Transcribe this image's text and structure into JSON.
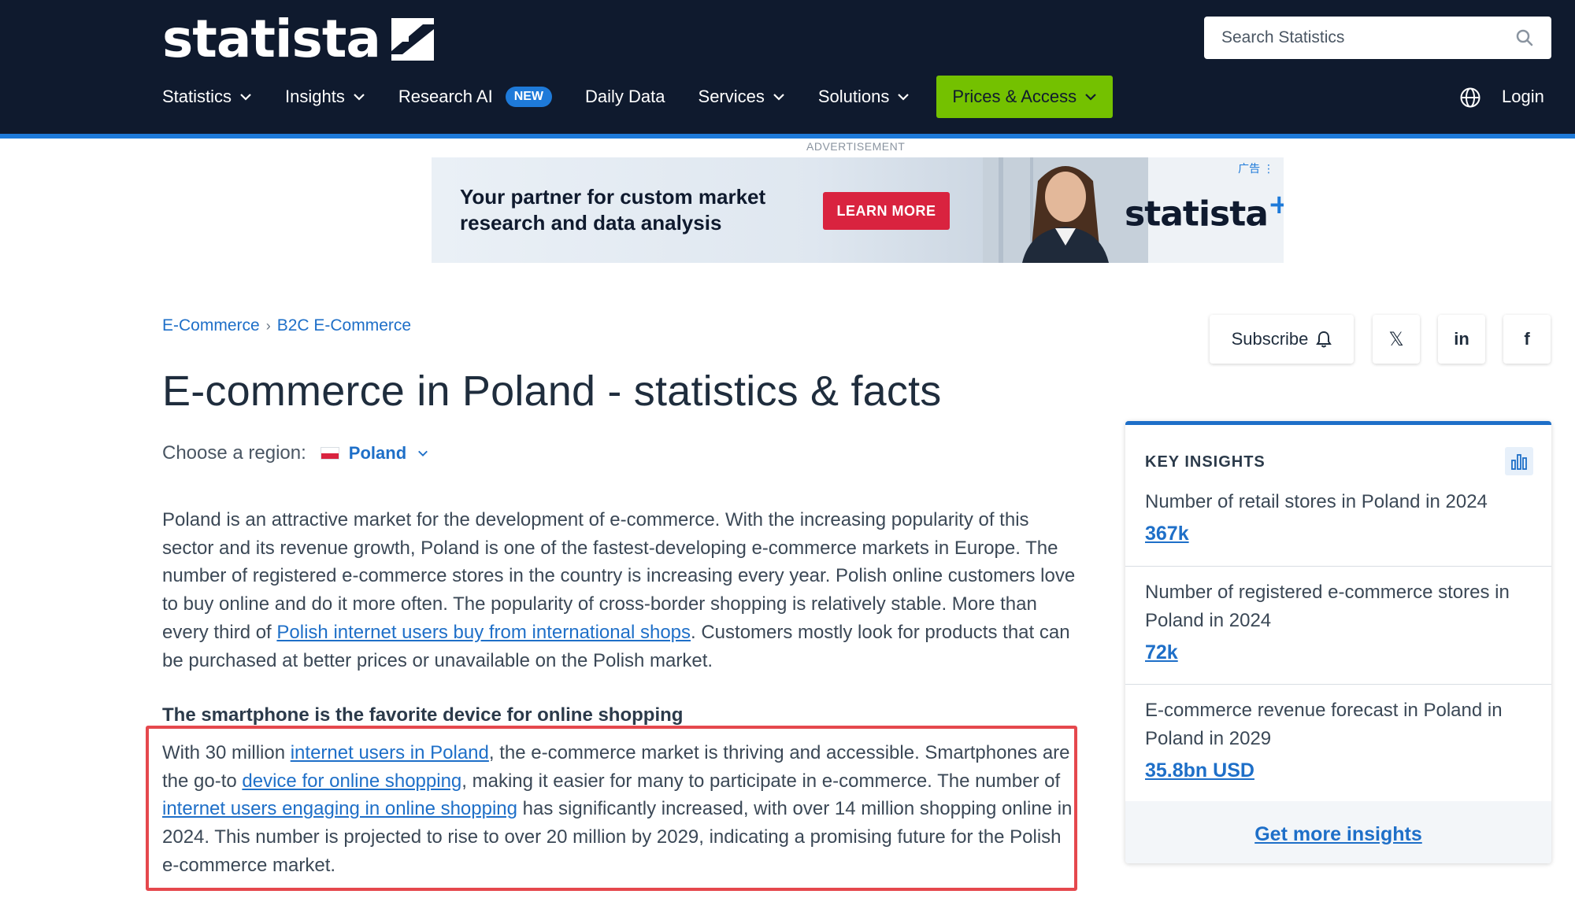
{
  "header": {
    "brand": "statista",
    "search_placeholder": "Search Statistics",
    "nav": [
      {
        "label": "Statistics"
      },
      {
        "label": "Insights"
      },
      {
        "label": "Research AI",
        "badge": "NEW"
      },
      {
        "label": "Daily Data"
      },
      {
        "label": "Services"
      },
      {
        "label": "Solutions"
      }
    ],
    "prices_label": "Prices & Access",
    "login_label": "Login"
  },
  "ad": {
    "label": "ADVERTISEMENT",
    "headline_line1": "Your partner for custom market",
    "headline_line2": "research and data analysis",
    "cta": "LEARN MORE",
    "brand": "statista",
    "brand_sup": "+",
    "corner": "广告 ⋮"
  },
  "breadcrumb": [
    "E-Commerce",
    "B2C E-Commerce"
  ],
  "breadcrumb_sep": "›",
  "title": "E-commerce in Poland - statistics & facts",
  "region": {
    "label": "Choose a region:",
    "value": "Poland"
  },
  "intro": {
    "before_link": "Poland is an attractive market for the development of e-commerce. With the increasing popularity of this sector and its revenue growth, Poland is one of the fastest-developing e-commerce markets in Europe. The number of registered e-commerce stores in the country is increasing every year. Polish online customers love to buy online and do it more often. The popularity of cross-border shopping is relatively stable. More than every third of ",
    "link": "Polish internet users buy from international shops",
    "after_link": ". Customers mostly look for products that can be purchased at better prices or unavailable on the Polish market."
  },
  "section": {
    "heading": "The smartphone is the favorite device for online shopping",
    "t1": "With 30 million ",
    "l1": "internet users in Poland",
    "t2": ", the e-commerce market is thriving and accessible. Smartphones are the go-to ",
    "l2": "device for online shopping",
    "t3": ", making it easier for many to participate in e-commerce. The number of ",
    "l3": "internet users engaging in online shopping",
    "t4": " has significantly increased, with over 14 million shopping online in 2024. This number is projected to rise to over 20 million by 2029, indicating a promising future for the Polish e-commerce market."
  },
  "social": {
    "subscribe": "Subscribe",
    "x": "𝕏",
    "linkedin": "in",
    "facebook": "f"
  },
  "insights": {
    "heading": "KEY INSIGHTS",
    "items": [
      {
        "label": "Number of retail stores in Poland in 2024",
        "value": "367k"
      },
      {
        "label": "Number of registered e-commerce stores in Poland in 2024",
        "value": "72k"
      },
      {
        "label": "E-commerce revenue forecast in Poland in Poland in 2029",
        "value": "35.8bn USD"
      }
    ],
    "more": "Get more insights"
  },
  "colors": {
    "header_bg": "#0f1a2e",
    "accent_blue": "#1e6fc8",
    "prices_green": "#74c100",
    "ad_cta_red": "#d9233f",
    "highlight_red": "#e5484d"
  }
}
